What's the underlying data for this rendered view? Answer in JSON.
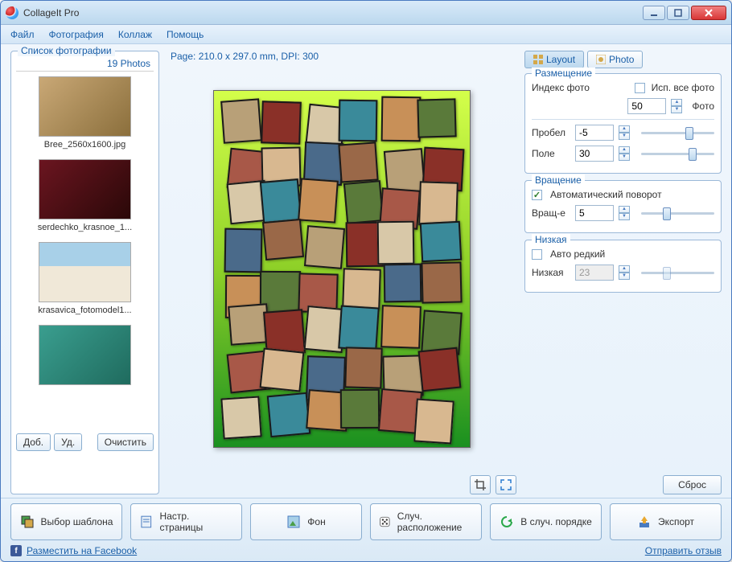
{
  "title": "CollageIt Pro",
  "menu": {
    "file": "Файл",
    "photo": "Фотография",
    "collage": "Коллаж",
    "help": "Помощь"
  },
  "photoList": {
    "title": "Список фотографии",
    "count": "19 Photos",
    "items": [
      {
        "name": "Bree_2560x1600.jpg"
      },
      {
        "name": "serdechko_krasnoe_1..."
      },
      {
        "name": "krasavica_fotomodel1..."
      },
      {
        "name": ""
      }
    ],
    "btnAdd": "Доб.",
    "btnDel": "Уд.",
    "btnClear": "Очистить"
  },
  "pageInfo": "Page: 210.0 x 297.0 mm, DPI: 300",
  "tabs": {
    "layout": "Layout",
    "photo": "Photo"
  },
  "placement": {
    "title": "Размещение",
    "indexLabel": "Индекс фото",
    "useAllLabel": "Исп. все фото",
    "useAll": false,
    "indexValue": "50",
    "photoSuffix": "Фото",
    "gapLabel": "Пробел",
    "gapValue": "-5",
    "fieldLabel": "Поле",
    "fieldValue": "30"
  },
  "rotation": {
    "title": "Вращение",
    "autoLabel": "Автоматический поворот",
    "auto": true,
    "rotLabel": "Вращ-е",
    "rotValue": "5"
  },
  "sparse": {
    "title": "Низкая",
    "autoLabel": "Авто редкий",
    "auto": false,
    "lowLabel": "Низкая",
    "lowValue": "23"
  },
  "btnReset": "Сброс",
  "bottom": {
    "template": "Выбор шаблона",
    "pageSetup": "Настр. страницы",
    "background": "Фон",
    "randomLayout": "Случ. расположение",
    "randomOrder": "В случ. порядке",
    "export": "Экспорт"
  },
  "footer": {
    "facebook": "Разместить на Facebook",
    "feedback": "Отправить отзыв"
  }
}
